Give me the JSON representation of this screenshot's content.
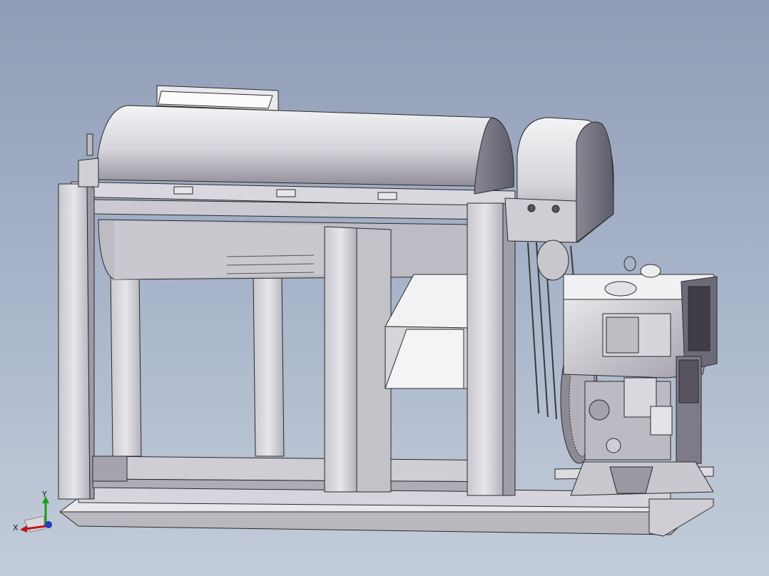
{
  "viewport": {
    "background_top": "#8f9cb5",
    "background_bottom": "#c3ccd9",
    "model_fill": "#e4e4e8",
    "model_shadow": "#9c9aa3",
    "edge_color": "#2a2a2a"
  },
  "triad": {
    "x_label": "X",
    "y_label": "Y",
    "x_color": "#c0141c",
    "y_color": "#1f9d1f",
    "z_color": "#1a3fbf"
  }
}
